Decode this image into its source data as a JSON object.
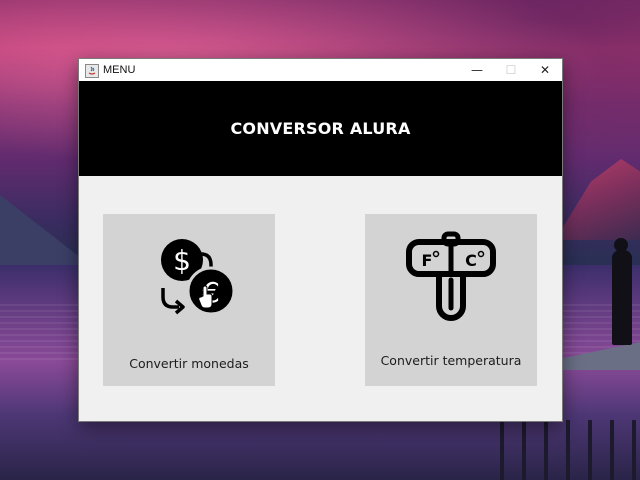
{
  "window": {
    "title": "MENU",
    "controls": {
      "minimize": "—",
      "maximize": "☐",
      "close": "✕"
    }
  },
  "header": {
    "title": "CONVERSOR ALURA"
  },
  "cards": {
    "money": {
      "label": "Convertir monedas",
      "icon": "currency-exchange-icon"
    },
    "temperature": {
      "label": "Convertir temperatura",
      "icon": "thermometer-fc-icon"
    }
  },
  "colors": {
    "header_bg": "#000000",
    "header_text": "#ffffff",
    "window_bg": "#f0f0f0",
    "card_bg": "#d3d3d3"
  }
}
